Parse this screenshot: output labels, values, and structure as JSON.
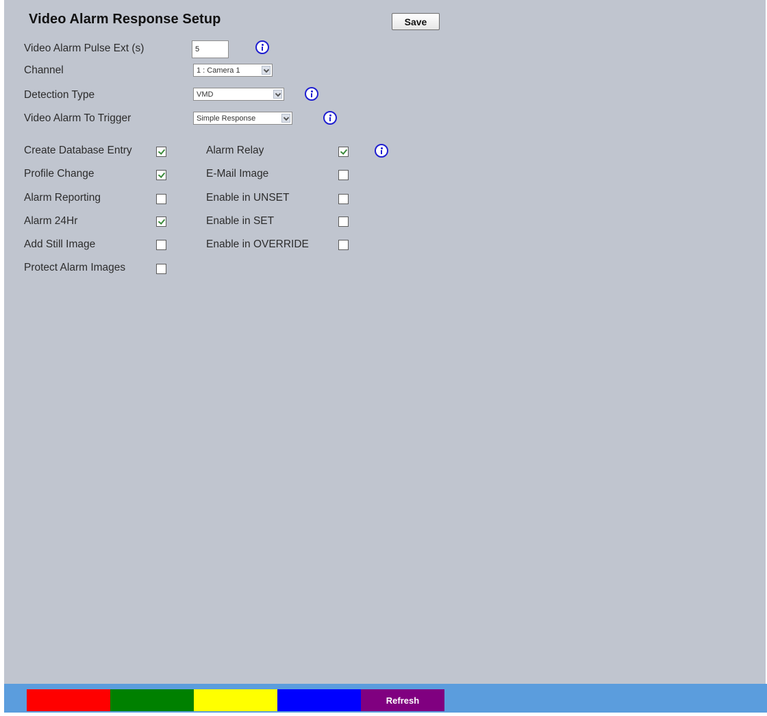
{
  "header": {
    "title": "Video Alarm Response Setup",
    "save_label": "Save"
  },
  "settings": {
    "pulse_ext": {
      "label": "Video Alarm Pulse Ext (s)",
      "value": "5"
    },
    "channel": {
      "label": "Channel",
      "value": "1 : Camera 1"
    },
    "detection_type": {
      "label": "Detection Type",
      "value": "VMD"
    },
    "alarm_trigger": {
      "label": "Video Alarm To Trigger",
      "value": "Simple Response"
    }
  },
  "options_left": [
    {
      "label": "Create Database Entry",
      "checked": true
    },
    {
      "label": "Profile Change",
      "checked": true
    },
    {
      "label": "Alarm Reporting",
      "checked": false
    },
    {
      "label": "Alarm 24Hr",
      "checked": true
    },
    {
      "label": "Add Still Image",
      "checked": false
    },
    {
      "label": "Protect Alarm Images",
      "checked": false
    }
  ],
  "options_right": [
    {
      "label": "Alarm Relay",
      "checked": true
    },
    {
      "label": "E-Mail Image",
      "checked": false
    },
    {
      "label": "Enable in UNSET",
      "checked": false
    },
    {
      "label": "Enable in SET",
      "checked": false
    },
    {
      "label": "Enable in OVERRIDE",
      "checked": false
    }
  ],
  "footer": {
    "buttons": [
      {
        "label": "",
        "color": "#ff0000"
      },
      {
        "label": "",
        "color": "#008000"
      },
      {
        "label": "",
        "color": "#ffff00"
      },
      {
        "label": "",
        "color": "#0000ff"
      },
      {
        "label": "Refresh",
        "color": "#800080"
      }
    ],
    "bar_color": "#5b9ddd"
  },
  "icons": {
    "info": "info-icon",
    "check": "checkbox-checked-icon"
  }
}
